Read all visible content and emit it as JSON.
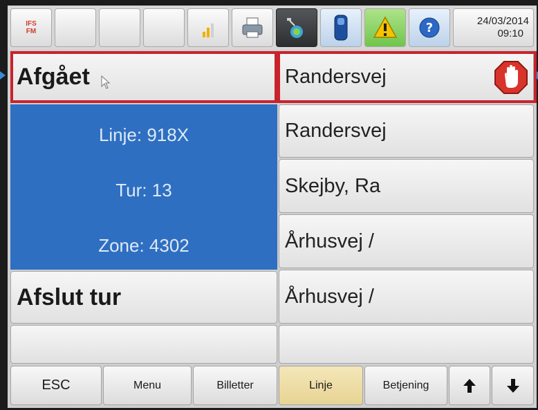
{
  "toolbar": {
    "logo_text": "IFS\nFM",
    "date": "24/03/2014",
    "time": "09:10",
    "icons": [
      "ifs-logo-icon",
      "signal-strength-icon",
      "printer-icon",
      "satellite-icon",
      "card-reader-icon",
      "warning-icon",
      "help-icon"
    ]
  },
  "status": {
    "label": "Afgået",
    "current_stop": "Randersvej",
    "stop_icon": "stop-hand-icon",
    "stop_icon_color": "#d9342b"
  },
  "trip_info": {
    "line": "Linje: 918X",
    "trip": "Tur: 13",
    "zone": "Zone: 4302",
    "panel_color": "#2e6fc2"
  },
  "stops": [
    "Randersvej",
    "Skejby, Ra",
    "Århusvej /",
    "Århusvej /",
    ""
  ],
  "actions": {
    "end_trip": "Afslut tur"
  },
  "bottom_bar": {
    "esc": "ESC",
    "menu": "Menu",
    "tickets": "Billetter",
    "line": "Linje",
    "operation": "Betjening",
    "up_icon": "arrow-up-icon",
    "down_icon": "arrow-down-icon"
  },
  "highlight_color": "#c8232c"
}
